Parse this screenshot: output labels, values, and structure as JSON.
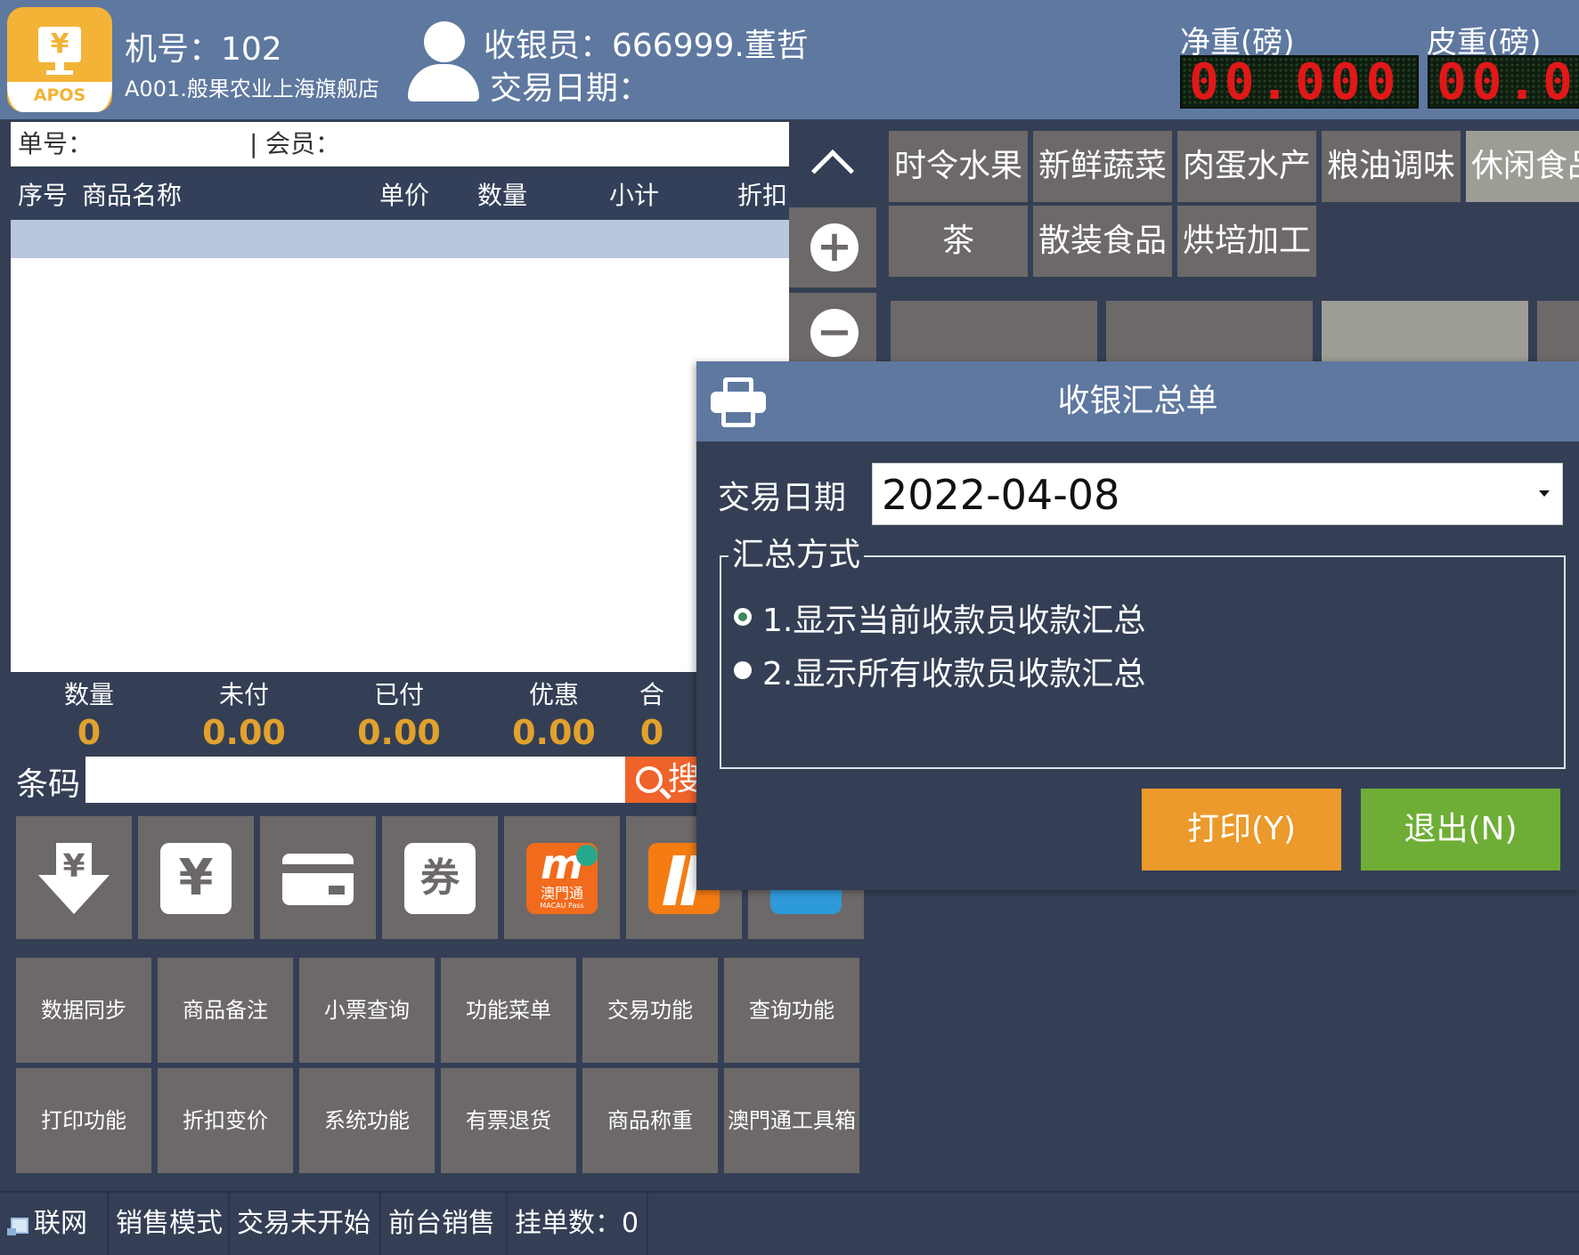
{
  "header": {
    "logo_text": "APOS",
    "machine": "机号：102",
    "store": "A001.般果农业上海旗舰店",
    "cashier": "收银员：666999.董哲",
    "trade_date": "交易日期：",
    "net_weight_label": "净重(磅)",
    "net_weight_value": "00.000",
    "tare_weight_label": "皮重(磅)",
    "tare_weight_value": "00.0"
  },
  "order": {
    "order_no_label": "单号：",
    "separator": "|",
    "member_label": "会员：",
    "columns": [
      "序号",
      "商品名称",
      "单价",
      "数量",
      "小计",
      "折扣"
    ]
  },
  "totals": [
    {
      "label": "数量",
      "value": "0"
    },
    {
      "label": "未付",
      "value": "0.00"
    },
    {
      "label": "已付",
      "value": "0.00"
    },
    {
      "label": "优惠",
      "value": "0.00"
    },
    {
      "label": "合",
      "value": "0"
    }
  ],
  "barcode": {
    "label": "条码",
    "search_label": "搜"
  },
  "payment": {
    "voucher_label": "券",
    "macau_m": "m",
    "macau_name": "澳門通",
    "macau_en": "MACAU Pass"
  },
  "functions": [
    [
      "数据同步",
      "商品备注",
      "小票查询",
      "功能菜单",
      "交易功能",
      "查询功能"
    ],
    [
      "打印功能",
      "折扣变价",
      "系统功能",
      "有票退货",
      "商品称重",
      "澳門通工具箱"
    ]
  ],
  "categories": [
    [
      "时令水果",
      "新鲜蔬菜",
      "肉蛋水产",
      "粮油调味",
      "休闲食品"
    ],
    [
      "茶",
      "散装食品",
      "烘培加工"
    ]
  ],
  "dialog": {
    "title": "收银汇总单",
    "date_label": "交易日期",
    "date_value": "2022-04-08",
    "group_label": "汇总方式",
    "options": [
      {
        "label": "1.显示当前收款员收款汇总",
        "checked": true
      },
      {
        "label": "2.显示所有收款员收款汇总",
        "checked": false
      }
    ],
    "print_label": "打印(Y)",
    "exit_label": "退出(N)"
  },
  "status": {
    "network": "联网",
    "mode": "销售模式",
    "trade_state": "交易未开始",
    "sale_type": "前台销售",
    "held": "挂单数：0"
  },
  "colors": {
    "header_bg": "#5e78a0",
    "panel_bg": "#343f55",
    "tile_bg": "#6d6969",
    "accent_orange": "#eb9a2b",
    "accent_green": "#6fae36",
    "value_gold": "#e2a12d",
    "led_red": "#e01818"
  }
}
